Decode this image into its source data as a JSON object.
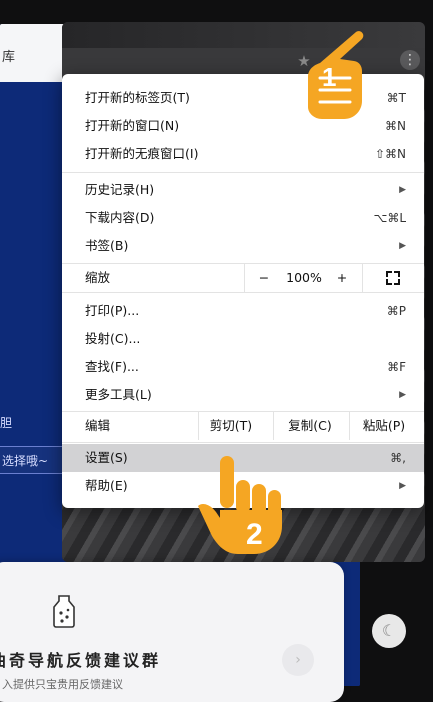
{
  "background_page": {
    "header_text": "库",
    "label_text": "胆",
    "select_text": "选择哦~"
  },
  "menu": {
    "group1": [
      {
        "label": "打开新的标签页(T)",
        "shortcut": "⌘T"
      },
      {
        "label": "打开新的窗口(N)",
        "shortcut": "⌘N"
      },
      {
        "label": "打开新的无痕窗口(I)",
        "shortcut": "⇧⌘N"
      }
    ],
    "group2": [
      {
        "label": "历史记录(H)",
        "submenu": "▶"
      },
      {
        "label": "下载内容(D)",
        "shortcut": "⌥⌘L"
      },
      {
        "label": "书签(B)",
        "submenu": "▶"
      }
    ],
    "zoom": {
      "label": "缩放",
      "minus": "−",
      "value": "100%",
      "plus": "+"
    },
    "group3": [
      {
        "label": "打印(P)...",
        "shortcut": "⌘P"
      },
      {
        "label": "投射(C)..."
      },
      {
        "label": "查找(F)...",
        "shortcut": "⌘F"
      },
      {
        "label": "更多工具(L)",
        "submenu": "▶"
      }
    ],
    "edit": {
      "label": "编辑",
      "cut": "剪切(T)",
      "copy": "复制(C)",
      "paste": "粘贴(P)"
    },
    "settings": {
      "label": "设置(S)",
      "shortcut": "⌘,"
    },
    "help": {
      "label": "帮助(E)",
      "submenu": "▶"
    }
  },
  "browser": {
    "star_icon": "★",
    "kebab_icon": "⋮"
  },
  "card": {
    "title": "曲奇导航反馈建议群",
    "subtitle": "入提供只宝贵用反馈建议",
    "arrow": "›"
  },
  "moon_icon": "☾",
  "annotations": {
    "step1": "1",
    "step2": "2"
  },
  "colors": {
    "hand": "#f5a623",
    "menu_highlight": "#d2d2d4",
    "page_blue": "#0d2a78"
  }
}
